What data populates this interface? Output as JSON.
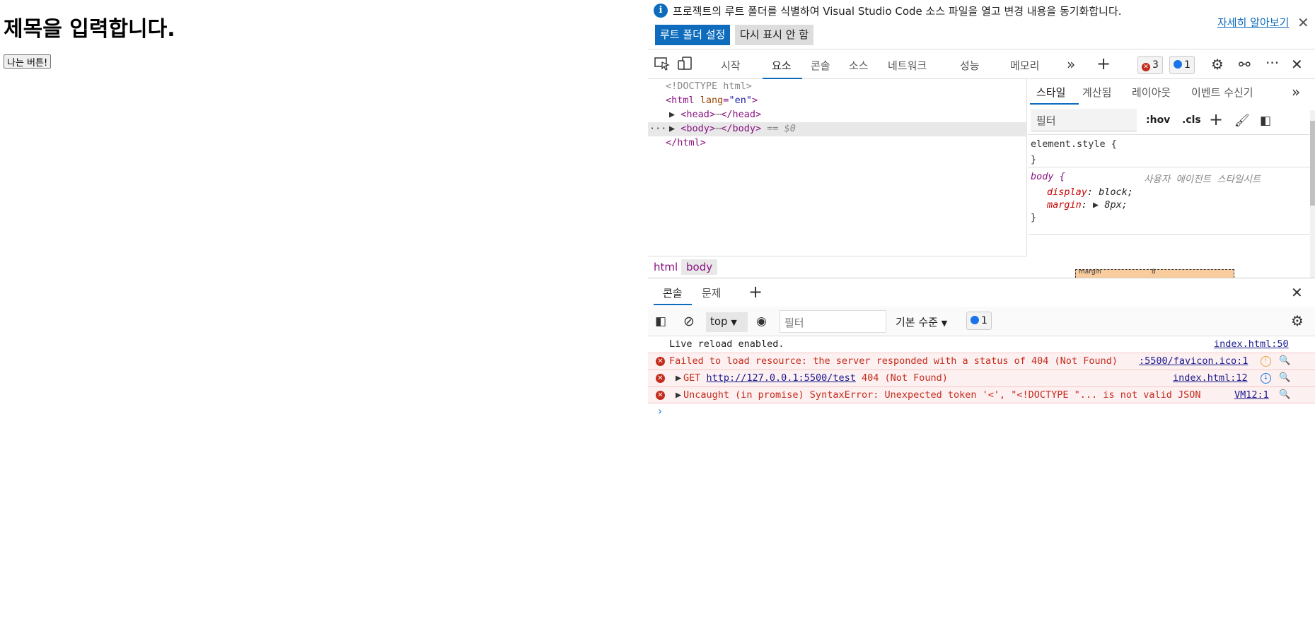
{
  "page": {
    "heading": "제목을 입력합니다.",
    "button_label": "나는 버튼!"
  },
  "infobar": {
    "message": "프로젝트의 루트 폴더를 식별하여 Visual Studio Code 소스 파일을 열고 변경 내용을 동기화합니다.",
    "learn_more": "자세히 알아보기",
    "set_root_button": "루트 폴더 설정",
    "dont_show_button": "다시 표시 안 함"
  },
  "devtools_tabs": [
    "시작",
    "요소",
    "콘솔",
    "소스",
    "네트워크",
    "성능",
    "메모리"
  ],
  "badges": {
    "errors": "3",
    "messages": "1"
  },
  "elements": {
    "doctype": "<!DOCTYPE html>",
    "html_open": "<html",
    "lang_attr": "lang",
    "lang_val": "\"en\"",
    "head": "<head>",
    "head_close": "</head>",
    "body": "<body>",
    "body_close": "</body>",
    "selected_marker": "== $0",
    "html_close": "</html>",
    "ellipsis": "···"
  },
  "breadcrumb": [
    "html",
    "body"
  ],
  "styles": {
    "tabs": [
      "스타일",
      "계산됨",
      "레이아웃",
      "이벤트 수신기"
    ],
    "filter_placeholder": "필터",
    "hov": ":hov",
    "cls": ".cls",
    "element_style": "element.style {",
    "close_brace": "}",
    "body_selector": "body {",
    "ua_label": "사용자 에이전트 스타일시트",
    "display_prop": "display",
    "display_val": "block;",
    "margin_prop": "margin",
    "margin_val": "8px;",
    "box_margin_label": "margin",
    "box_margin_value": "8"
  },
  "drawer": {
    "tabs": [
      "콘솔",
      "문제"
    ],
    "context": "top",
    "filter_placeholder": "필터",
    "level": "기본 수준",
    "msg_count": "1"
  },
  "console": [
    {
      "type": "log",
      "text": "Live reload enabled.",
      "source": "index.html:50"
    },
    {
      "type": "error",
      "text": "Failed to load resource: the server responded with a status of 404 (Not Found)",
      "source": ":5500/favicon.ico:1"
    },
    {
      "type": "error",
      "prefix": "GET ",
      "link": "http://127.0.0.1:5500/test",
      "suffix": " 404 (Not Found)",
      "source": "index.html:12"
    },
    {
      "type": "error",
      "text": "Uncaught (in promise) SyntaxError: Unexpected token '<', \"<!DOCTYPE \"... is not valid JSON",
      "source": "VM12:1"
    }
  ],
  "colors": {
    "accent": "#0f6cbd",
    "error": "#c42b1c",
    "tag": "#881280"
  }
}
